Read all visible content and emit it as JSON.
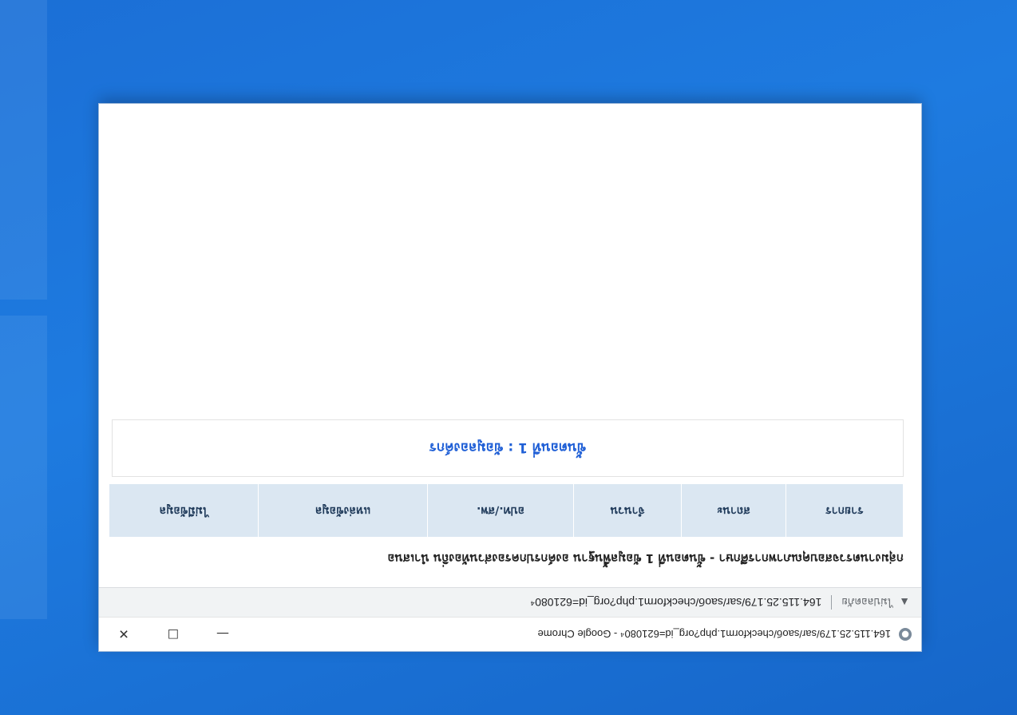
{
  "window": {
    "title": "164.115.25.179/sar/saoб/checkform1.php?org_id=621080⁴ - Google Chrome",
    "minimize_symbol": "—",
    "maximize_symbol": "☐",
    "close_symbol": "✕",
    "favicon": "globe-icon"
  },
  "addressbar": {
    "warning_icon": "warning-icon",
    "not_secure_label": "ไม่ปลอดภัย",
    "url": "164.115.25.179/sar/saoб/checkform1.php?org_id=621080⁴"
  },
  "page": {
    "heading": "กลุ่มงานตรวจสอบคุณภาพการศึกษา - ขั้นตอนที่ 1 ข้อมูลพื้นฐาน องค์กรปกครองส่วนท้องถิ่น นำเสนอ"
  },
  "nav_tabs": [
    {
      "label": "รายการ"
    },
    {
      "label": "สถานะ"
    },
    {
      "label": "จำนวน"
    },
    {
      "label": "อปท./สพ."
    },
    {
      "label": "แหล่งข้อมูล"
    },
    {
      "label": "ไม่มีข้อมูล"
    }
  ],
  "section": {
    "title": "ขั้นตอนที่ 1 : ข้อมูลองค์กร"
  }
}
